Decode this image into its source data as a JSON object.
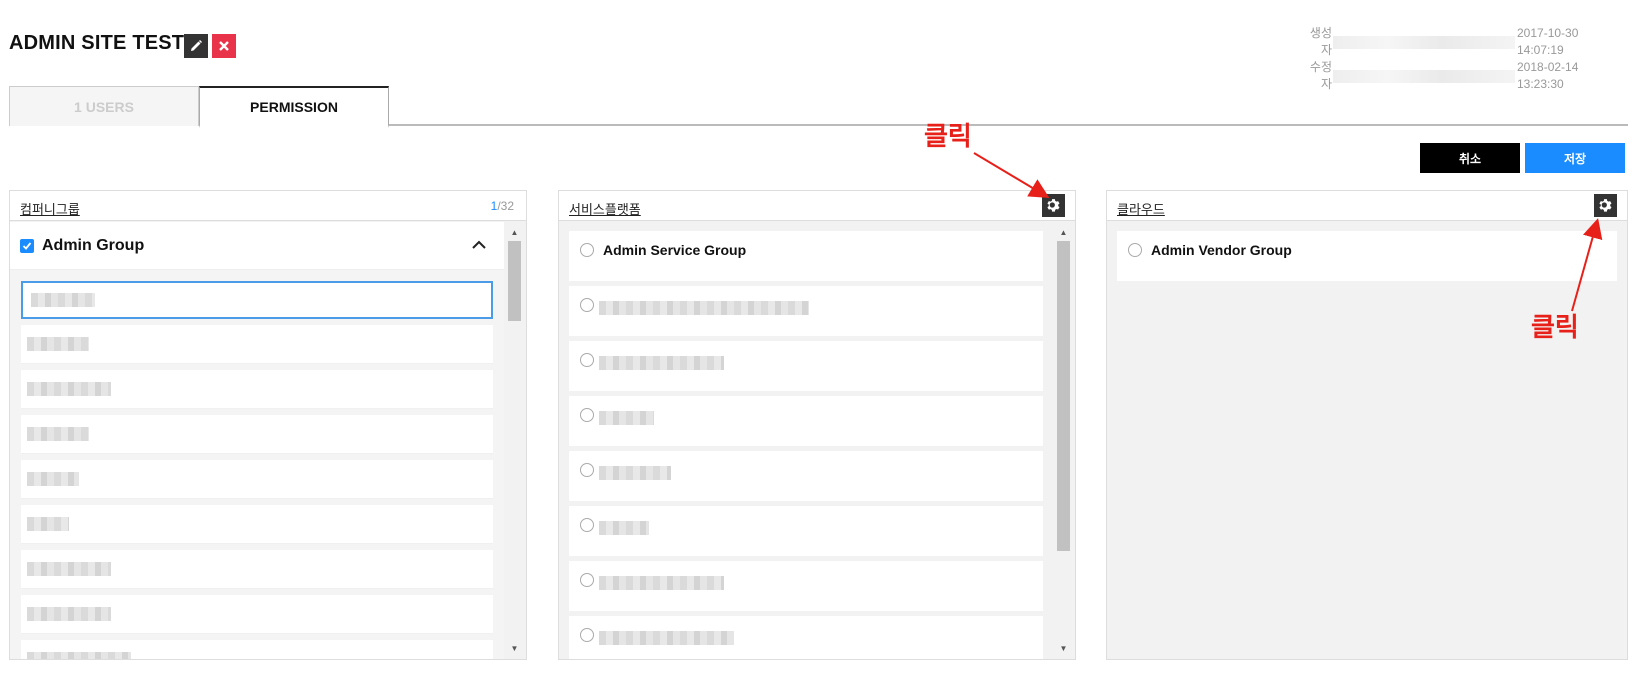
{
  "header": {
    "title": "ADMIN SITE TEST",
    "created_label": "생성자",
    "created_value": "2017-10-30 14:07:19",
    "modified_label": "수정자",
    "modified_value": "2018-02-14 13:23:30"
  },
  "tabs": [
    {
      "label": "1 USERS",
      "active": false
    },
    {
      "label": "PERMISSION",
      "active": true
    }
  ],
  "actions": {
    "cancel_label": "취소",
    "save_label": "저장"
  },
  "panels": {
    "company": {
      "title": "컴퍼니그룹",
      "count_current": "1",
      "count_total": "/32",
      "group": {
        "label": "Admin Group",
        "checked": true
      }
    },
    "service": {
      "title": "서비스플랫폼",
      "items": [
        {
          "label": "Admin Service Group"
        }
      ]
    },
    "cloud": {
      "title": "클라우드",
      "items": [
        {
          "label": "Admin Vendor Group"
        }
      ]
    }
  },
  "annotations": {
    "click_1": "클릭",
    "click_2": "클릭"
  },
  "colors": {
    "accent": "#1a8cff",
    "danger": "#e8334a",
    "annotation": "#e8201a"
  }
}
